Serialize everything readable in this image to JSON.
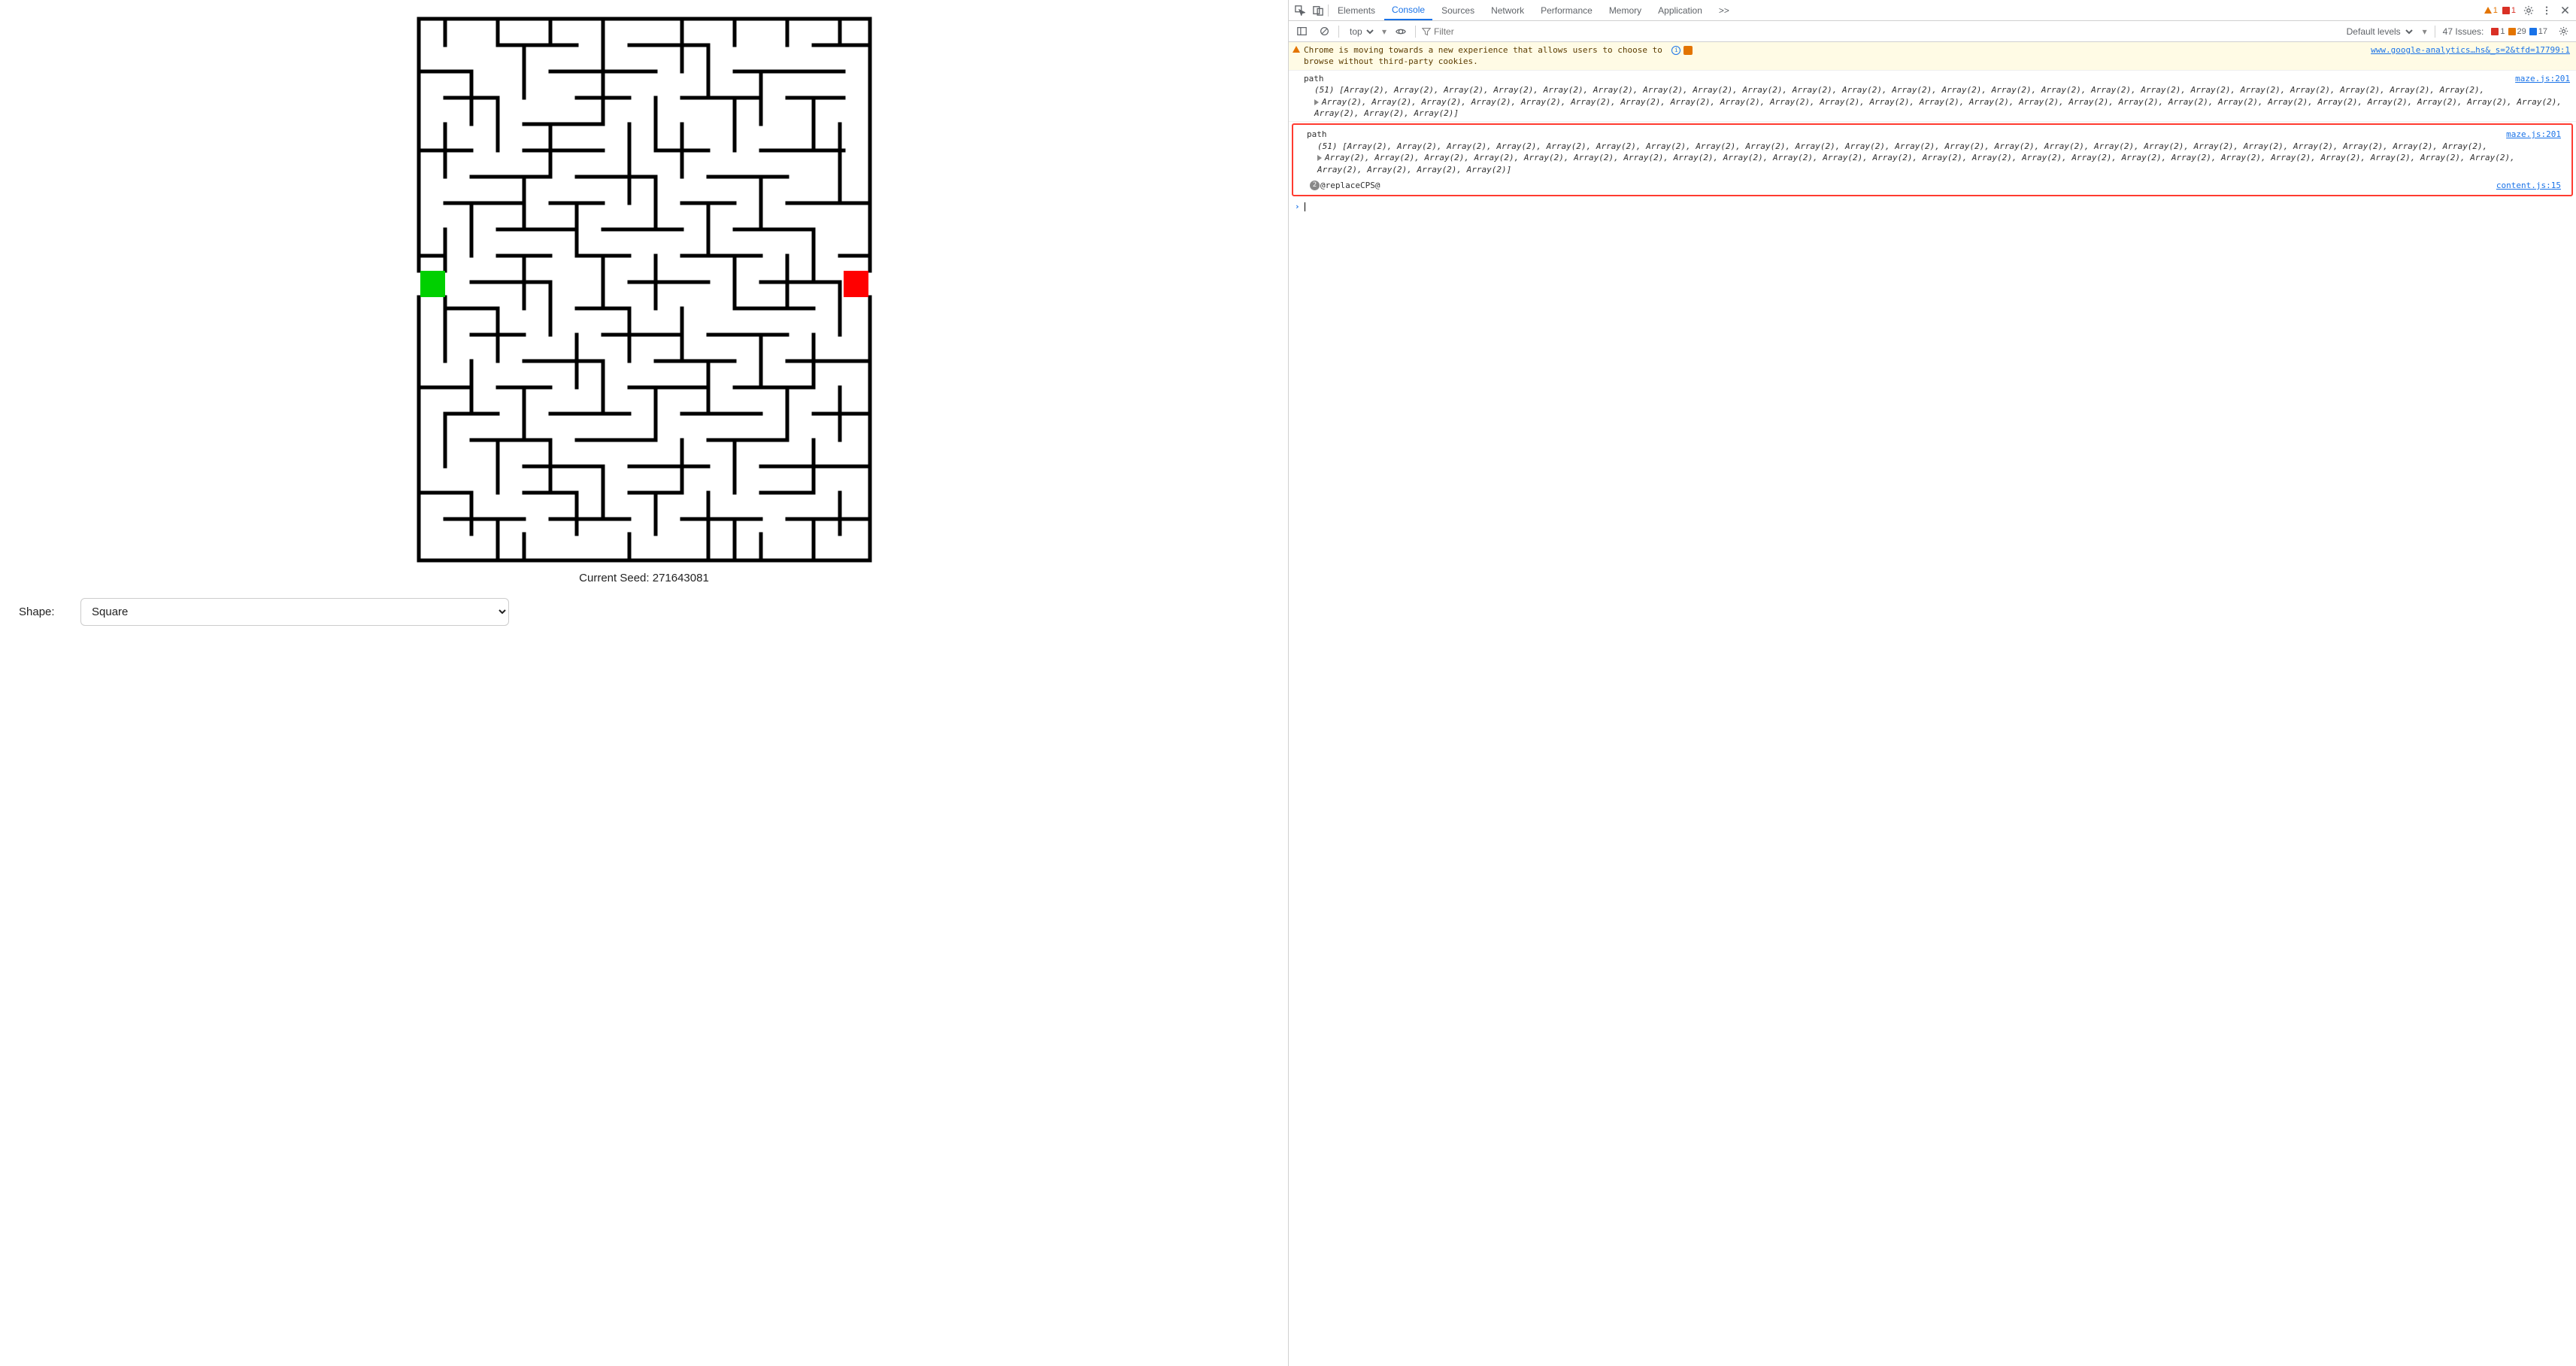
{
  "page": {
    "seed_label": "Current Seed: 271643081",
    "shape_label": "Shape:",
    "shape_selected": "Square"
  },
  "devtools": {
    "tabs": {
      "elements": "Elements",
      "console": "Console",
      "sources": "Sources",
      "network": "Network",
      "performance": "Performance",
      "memory": "Memory",
      "application": "Application",
      "more": ">>"
    },
    "tabbar_badges": {
      "warn": "1",
      "err": "1"
    },
    "toolbar": {
      "context": "top",
      "filter_placeholder": "Filter",
      "levels": "Default levels",
      "issues_label": "47 Issues:",
      "issues": {
        "red": "1",
        "orange": "29",
        "blue": "17"
      }
    },
    "warning": {
      "text_prefix": "Chrome is moving towards a new experience that allows users to choose to ",
      "link": "www.google-analytics…hs&_s=2&tfd=17799:1",
      "text_suffix": "browse without third-party cookies."
    },
    "log1": {
      "label": "path",
      "src": "maze.js:201",
      "line1": "(51) [Array(2), Array(2), Array(2), Array(2), Array(2), Array(2), Array(2), Array(2), Array(2), Array(2), Array(2), Array(2), Array(2), Array(2), Array(2), Array(2), Array(2), Array(2), Array(2), Array(2), Array(2), Array(2), Array(2),",
      "line2": "Array(2), Array(2), Array(2), Array(2), Array(2), Array(2), Array(2), Array(2), Array(2), Array(2), Array(2), Array(2), Array(2), Array(2), Array(2), Array(2), Array(2), Array(2), Array(2), Array(2), Array(2), Array(2), Array(2), Array(2), Array(2), Array(2), Array(2), Array(2)]"
    },
    "log2": {
      "label": "path",
      "src": "maze.js:201",
      "line1": "(51) [Array(2), Array(2), Array(2), Array(2), Array(2), Array(2), Array(2), Array(2), Array(2), Array(2), Array(2), Array(2), Array(2), Array(2), Array(2), Array(2), Array(2), Array(2), Array(2), Array(2), Array(2), Array(2), Array(2),",
      "line2": "Array(2), Array(2), Array(2), Array(2), Array(2), Array(2), Array(2), Array(2), Array(2), Array(2), Array(2), Array(2), Array(2), Array(2), Array(2), Array(2), Array(2), Array(2), Array(2), Array(2), Array(2), Array(2), Array(2), Array(2), Array(2), Array(2), Array(2), Array(2)]"
    },
    "err_entry": {
      "count": "2",
      "text": "@replaceCPS@",
      "src": "content.js:15"
    }
  }
}
